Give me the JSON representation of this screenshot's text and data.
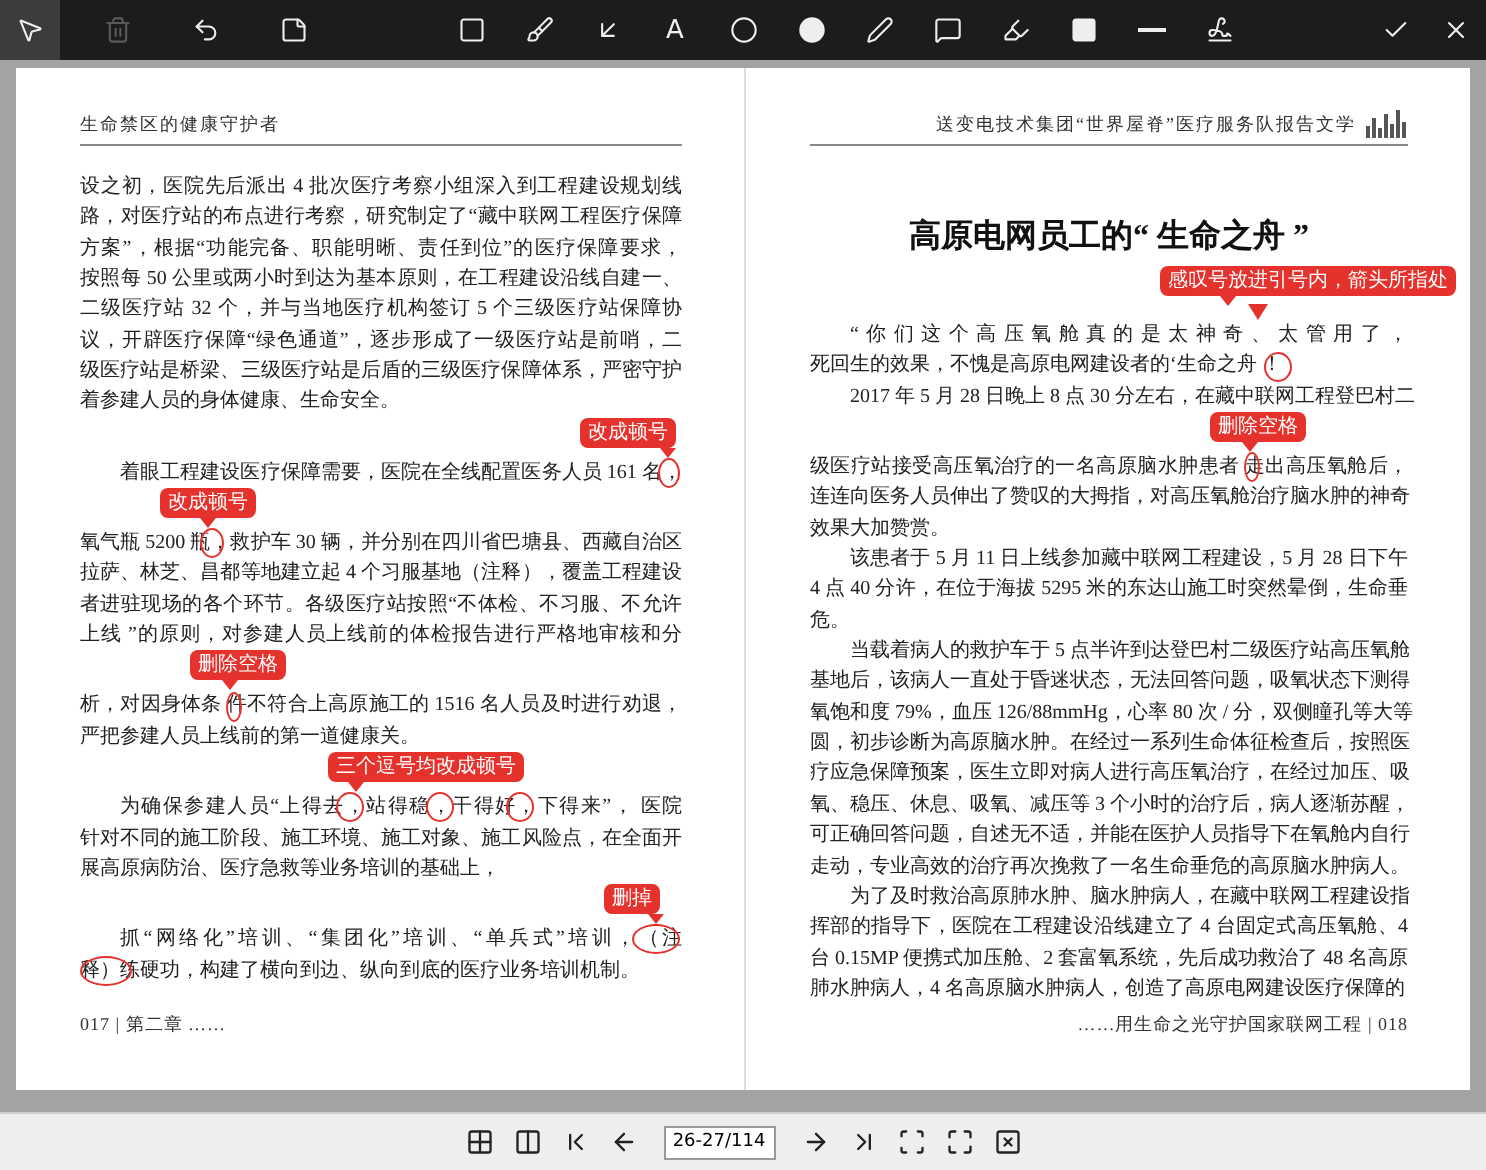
{
  "toolbar": {
    "left": [
      {
        "kind": "select",
        "selected": true,
        "disabled": false
      },
      {
        "kind": "delete",
        "selected": false,
        "disabled": true
      },
      {
        "kind": "undo",
        "selected": false,
        "disabled": false
      },
      {
        "kind": "notes",
        "selected": false,
        "disabled": false
      }
    ],
    "tools": [
      {
        "kind": "rectangle",
        "selected": false
      },
      {
        "kind": "brush",
        "selected": false
      },
      {
        "kind": "arrow",
        "selected": false
      },
      {
        "kind": "text",
        "label": "A",
        "selected": false
      },
      {
        "kind": "ellipse",
        "selected": false
      },
      {
        "kind": "filled-ellipse",
        "selected": false
      },
      {
        "kind": "pen",
        "selected": false
      },
      {
        "kind": "comment",
        "selected": false
      },
      {
        "kind": "highlighter",
        "selected": false
      },
      {
        "kind": "filled-rectangle",
        "selected": false
      },
      {
        "kind": "line",
        "selected": false
      },
      {
        "kind": "signature",
        "selected": false
      }
    ],
    "actions": [
      {
        "kind": "confirm"
      },
      {
        "kind": "close"
      }
    ]
  },
  "pages": [
    {
      "header": "生命禁区的健康守护者",
      "paragraphs": [
        {
          "indent": false,
          "lines": [
            "设之初，医院先后派出 4 批次医疗考察小组深入到工程建设规划线",
            "路，对医疗站的布点进行考察，研究制定了“藏中联网工程医疗保障",
            "方案”，根据“功能完备、职能明晰、责任到位”的医疗保障要求，",
            "按照每 50 公里或两小时到达为基本原则，在工程建设沿线自建一、",
            "二级医疗站 32 个，并与当地医疗机构签订 5 个三级医疗站保障协",
            "议，开辟医疗保障“绿色通道”，逐步形成了一级医疗站是前哨，二",
            "级医疗站是桥梁、三级医疗站是后盾的三级医疗保障体系，严密守护",
            "着参建人员的身体健康、生命安全。"
          ]
        },
        {
          "indent": true,
          "lines": [
            "着眼工程建设医疗保障需要，医院在全线配置医务人员 161 名，",
            "氧气瓶 5200 瓶，救护车 30 辆，并分别在四川省巴塘县、西藏自治区",
            "拉萨、林芝、昌都等地建立起 4 个习服基地（注释），覆盖工程建设",
            "者进驻现场的各个环节。各级医疗站按照“不体检、不习服、不允许",
            "上线 ”的原则，对参建人员上线前的体检报告进行严格地审核和分",
            "析，对因身体条 件不符合上高原施工的 1516 名人员及时进行劝退，",
            "严把参建人员上线前的第一道健康关。"
          ]
        },
        {
          "indent": true,
          "lines": [
            "为确保参建人员“上得去，站得稳，干得好，下得来”， 医院",
            "针对不同的施工阶段、施工环境、施工对象、施工风险点，在全面开",
            "展高原病防治、医疗急救等业务培训的基础上，"
          ]
        },
        {
          "indent": true,
          "lines": [
            "抓“网络化”培训、“集团化”培训、“单兵式”培训，（注",
            "释）练硬功，构建了横向到边、纵向到底的医疗业务培训机制。"
          ]
        }
      ],
      "footer": "017 | 第二章 ……",
      "annotations": [
        {
          "text": "改成顿号"
        },
        {
          "text": "改成顿号"
        },
        {
          "text": "删除空格"
        },
        {
          "text": "三个逗号均改成顿号"
        },
        {
          "text": "删掉"
        }
      ]
    },
    {
      "header": "送变电技术集团“世界屋脊”医疗服务队报告文学",
      "title": "高原电网员工的“ 生命之舟 ”",
      "paragraphs": [
        {
          "indent": true,
          "lines": [
            "“你们这个高压氧舱真的是太神奇、太管用了，",
            "死回生的效果，不愧是高原电网建设者的‘生命之舟 ！"
          ]
        },
        {
          "indent": true,
          "lines": [
            "2017 年 5 月 28 日晚上 8 点 30 分左右，在藏中联网工程登巴村二",
            "级医疗站接受高压氧治疗的一名高原脑水肿患者 走出高压氧舱后，",
            "连连向医务人员伸出了赞叹的大拇指，对高压氧舱治疗脑水肿的神奇",
            "效果大加赞赏。"
          ]
        },
        {
          "indent": true,
          "lines": [
            "该患者于 5 月 11 日上线参加藏中联网工程建设，5 月 28 日下午",
            "4 点 40 分许，在位于海拔 5295 米的东达山施工时突然晕倒，生命垂",
            "危。"
          ]
        },
        {
          "indent": true,
          "lines": [
            "当载着病人的救护车于 5 点半许到达登巴村二级医疗站高压氧舱",
            "基地后，该病人一直处于昏迷状态，无法回答问题，吸氧状态下测得",
            "氧饱和度 79%，血压 126/88mmHg，心率 80 次 / 分，双侧瞳孔等大等",
            "圆，初步诊断为高原脑水肿。在经过一系列生命体征检查后，按照医",
            "疗应急保障预案，医生立即对病人进行高压氧治疗，在经过加压、吸",
            "氧、稳压、休息、吸氧、减压等 3 个小时的治疗后，病人逐渐苏醒，",
            "可正确回答问题，自述无不适，并能在医护人员指导下在氧舱内自行",
            "走动，专业高效的治疗再次挽救了一名生命垂危的高原脑水肿病人。"
          ]
        },
        {
          "indent": true,
          "lines": [
            "为了及时救治高原肺水肿、脑水肿病人，在藏中联网工程建设指",
            "挥部的指导下，医院在工程建设沿线建立了 4 台固定式高压氧舱、4",
            "台 0.15MP 便携式加压舱、2 套富氧系统，先后成功救治了 48 名高原",
            "肺水肿病人，4 名高原脑水肿病人，创造了高原电网建设医疗保障的"
          ]
        }
      ],
      "footer": "……用生命之光守护国家联网工程 | 018",
      "annotations": [
        {
          "text": "感叹号放进引号内，箭头所指处"
        },
        {
          "text": "删除空格"
        }
      ]
    }
  ],
  "nav": {
    "before": [
      {
        "kind": "thumbnails"
      },
      {
        "kind": "spread"
      },
      {
        "kind": "first"
      },
      {
        "kind": "previous"
      }
    ],
    "page_field": {
      "value": "26-27/114"
    },
    "after": [
      {
        "kind": "next"
      },
      {
        "kind": "last"
      },
      {
        "kind": "fit-width"
      },
      {
        "kind": "fit-page"
      },
      {
        "kind": "close-view"
      }
    ]
  }
}
